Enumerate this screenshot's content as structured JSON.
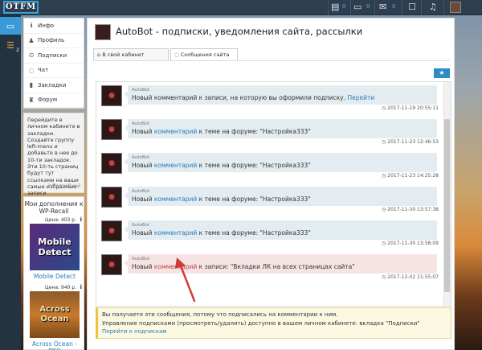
{
  "topbar": {
    "logo": "OTFM",
    "icons": [
      {
        "icon": "wallet-icon",
        "count": "0"
      },
      {
        "icon": "chat-icon",
        "count": "0"
      },
      {
        "icon": "inbox-icon",
        "count": "0"
      },
      {
        "icon": "bookmark-icon",
        "count": ""
      },
      {
        "icon": "bell-icon",
        "count": ""
      }
    ]
  },
  "rail": {
    "items": [
      {
        "icon": "laptop-icon",
        "badge": ""
      },
      {
        "icon": "wifi-icon",
        "badge": "2"
      }
    ]
  },
  "sidebar": {
    "items": [
      {
        "icon": "info-icon",
        "label": "Инфо"
      },
      {
        "icon": "user-icon",
        "label": "Профиль"
      },
      {
        "icon": "check-icon",
        "label": "Подписки"
      },
      {
        "icon": "chat-icon",
        "label": "Чат"
      },
      {
        "icon": "bookmark-icon",
        "label": "Закладки"
      },
      {
        "icon": "forum-icon",
        "label": "Форум"
      }
    ]
  },
  "promo": {
    "text": "Перейдите в личном кабинете в закладки. Создайте группу left-menu и добавьте в нее до 10-ти закладок. Эти 10-ть страниц будут тут ссылками на ваши самые избранные записи",
    "more": "Подробней"
  },
  "addons": {
    "title": "Мои дополнения к WP-Recall",
    "items": [
      {
        "price": "Цена: 403 р.",
        "image_text": "Mobile Detect",
        "name": "Mobile Detect"
      },
      {
        "price": "Цена: 940 р.",
        "image_text": "Across Ocean",
        "name": "Across Ocean - PRO"
      }
    ]
  },
  "header": {
    "title": "AutoBot - подписки, уведомления сайта, рассылки"
  },
  "tabs": [
    {
      "icon": "home-icon",
      "label": "В свой кабинет"
    },
    {
      "icon": "chat-icon",
      "label": "Сообщения сайта"
    }
  ],
  "messages": [
    {
      "author": "AutoBot",
      "before": "Новый комментарий к записи, на которую вы оформили подписку.",
      "link": "Перейти",
      "after": "",
      "time": "2017-11-19 20:55:11",
      "unread": false
    },
    {
      "author": "AutoBot",
      "before": "Новый ",
      "link": "комментарий",
      "after": " к теме на форуме: \"Настройка333\"",
      "time": "2017-11-23 12:46:53",
      "unread": false
    },
    {
      "author": "AutoBot",
      "before": "Новый ",
      "link": "комментарий",
      "after": " к теме на форуме: \"Настройка333\"",
      "time": "2017-11-23 14:25:28",
      "unread": false
    },
    {
      "author": "AutoBot",
      "before": "Новый ",
      "link": "комментарий",
      "after": " к теме на форуме: \"Настройка333\"",
      "time": "2017-11-30 13:57:38",
      "unread": false
    },
    {
      "author": "AutoBot",
      "before": "Новый ",
      "link": "комментарий",
      "after": " к теме на форуме: \"Настройка333\"",
      "time": "2017-11-30 13:58:09",
      "unread": false
    },
    {
      "author": "AutoBot",
      "before": "Новый ",
      "link": "комментарий",
      "after": " к записи: \"Вкладки ЛК на всех страницах сайта\"",
      "time": "2017-12-02 11:55:07",
      "unread": true
    }
  ],
  "notice": {
    "line1": "Вы получаете эти сообщения, потому что подписались на комментарии к ним.",
    "line2": "Управление подписками (просмотреть/удалить) доступно в вашем личном кабинете: вкладка \"Подписки\"",
    "link": "Перейти к подпискам"
  }
}
